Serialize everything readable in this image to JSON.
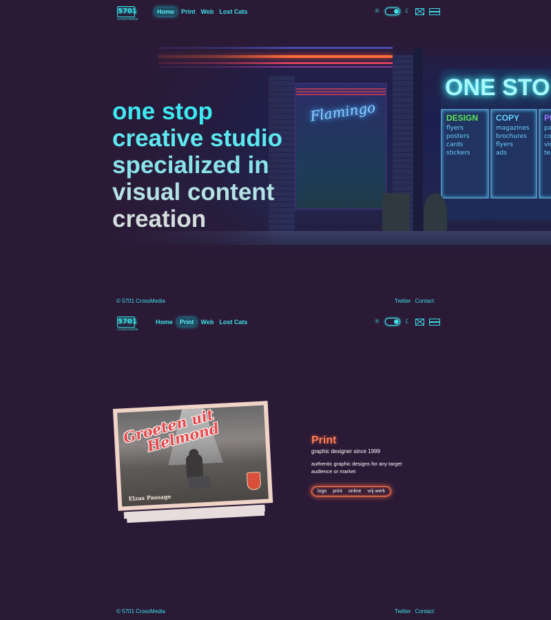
{
  "logo": {
    "number": "5701",
    "tagline": "crossmedia"
  },
  "nav": {
    "links": [
      "Home",
      "Print",
      "Web",
      "Lost Cats"
    ],
    "tools": {
      "theme_light": "☼",
      "theme_dark": "☾"
    }
  },
  "hero": {
    "title_lines": [
      "one stop",
      "creative studio",
      "specialized in",
      "visual content",
      "creation"
    ],
    "sign_flamingo": "Flamingo",
    "store_sign": "ONE STO",
    "store_columns": [
      {
        "head": "DESIGN",
        "items": [
          "flyers",
          "posters",
          "cards",
          "stickers"
        ]
      },
      {
        "head": "COPY",
        "items": [
          "magazines",
          "brochures",
          "flyers",
          "ads"
        ]
      },
      {
        "head": "PR",
        "items": [
          "pa",
          "co",
          "vin",
          "tex"
        ]
      }
    ]
  },
  "footer": {
    "copyright": "© 5701 CrossMedia",
    "links": [
      "Twitter",
      "Contact"
    ]
  },
  "print": {
    "postcard": {
      "greeting_line1": "Groeten uit",
      "greeting_line2": "Helmond",
      "caption": "Elzas Passage"
    },
    "title": "Print",
    "subtitle": "graphic designer since 1999",
    "description": "authentic graphic designs for any target audience or market",
    "tags": [
      "logo",
      "print",
      "online",
      "vrij werk"
    ]
  },
  "colors": {
    "accent": "#3ee0e8",
    "print_accent": "#ff7d54",
    "background": "#2a1a36"
  }
}
